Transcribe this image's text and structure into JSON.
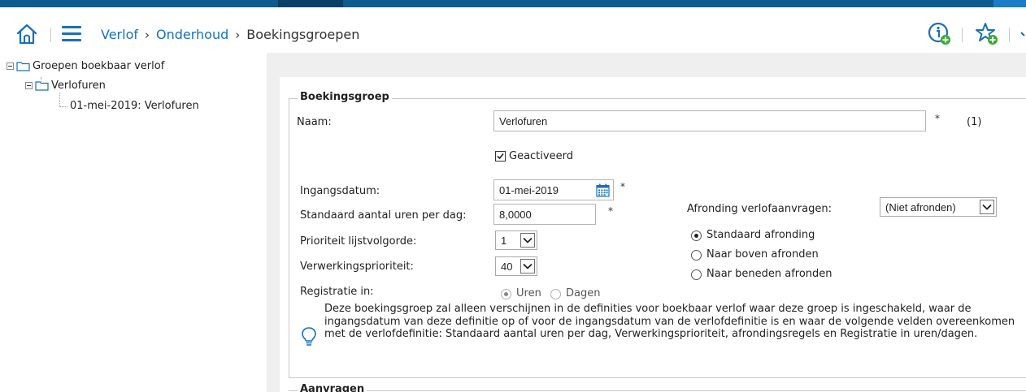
{
  "header": {
    "breadcrumb": [
      {
        "label": "Verlof"
      },
      {
        "label": "Onderhoud"
      },
      {
        "label": "Boekingsgroepen"
      }
    ],
    "separator": "›"
  },
  "tree": {
    "root": {
      "label": "Groepen boekbaar verlof"
    },
    "child": {
      "label": "Verlofuren"
    },
    "leaf": {
      "label": "01-mei-2019: Verlofuren"
    }
  },
  "form": {
    "section_title": "Boekingsgroep",
    "next_section_title": "Aanvragen",
    "naam": {
      "label": "Naam:",
      "value": "Verlofuren",
      "required": "*",
      "counter": "(1)"
    },
    "geactiveerd": {
      "label": "Geactiveerd",
      "checked": true
    },
    "ingangsdatum": {
      "label": "Ingangsdatum:",
      "value": "01-mei-2019",
      "required": "*"
    },
    "uren_per_dag": {
      "label": "Standaard aantal uren per dag:",
      "value": "8,0000",
      "required": "*"
    },
    "prioriteit_lijst": {
      "label": "Prioriteit lijstvolgorde:",
      "value": "1"
    },
    "verwerkingsprioriteit": {
      "label": "Verwerkingsprioriteit:",
      "value": "40"
    },
    "registratie": {
      "label": "Registratie in:",
      "options": [
        {
          "label": "Uren",
          "selected": true
        },
        {
          "label": "Dagen",
          "selected": false
        }
      ]
    },
    "afronding": {
      "label": "Afronding verlofaanvragen:",
      "value": "(Niet afronden)",
      "options": [
        {
          "label": "Standaard afronding",
          "selected": true
        },
        {
          "label": "Naar boven afronden",
          "selected": false
        },
        {
          "label": "Naar beneden afronden",
          "selected": false
        }
      ]
    },
    "info": "Deze boekingsgroep zal alleen verschijnen in de definities voor boekbaar verlof waar deze groep is ingeschakeld, waar de ingangsdatum van deze definitie op of voor de ingangsdatum van de verlofdefinitie is en waar de volgende velden overeenkomen met de verlofdefinitie: Standaard aantal uren per dag, Verwerkingsprioriteit, afrondingsregels en Registratie in uren/dagen."
  },
  "colors": {
    "brand": "#0f5a8f",
    "link": "#1a6fba",
    "icon_green": "#3aa935"
  }
}
